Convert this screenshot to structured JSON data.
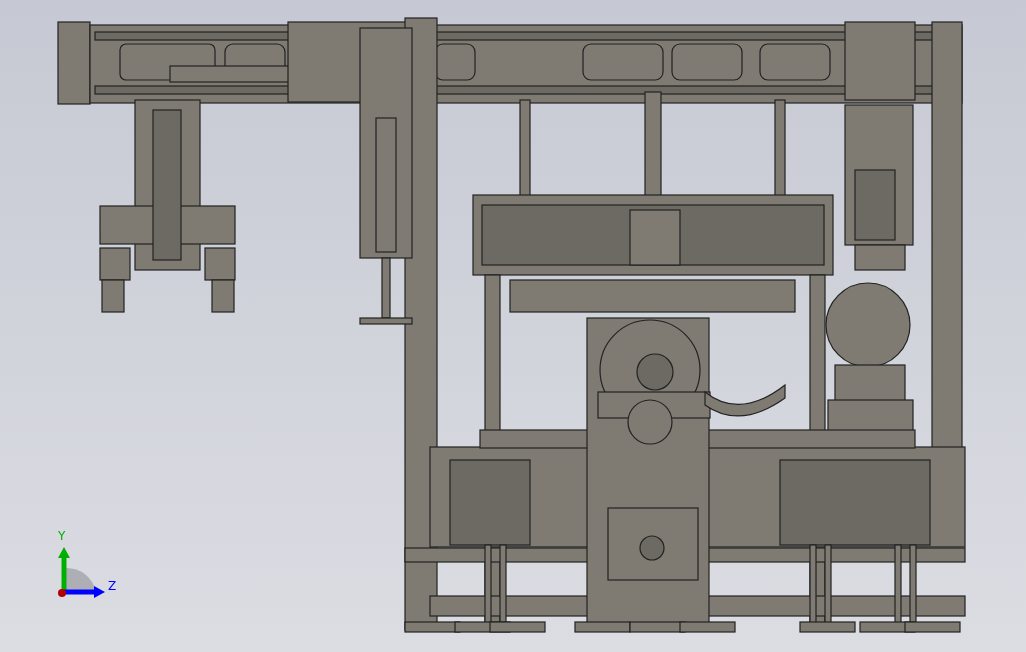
{
  "viewport": {
    "triad": {
      "axes": [
        {
          "label": "Y",
          "color": "#00b000"
        },
        {
          "label": "Z",
          "color": "#0000ff"
        }
      ]
    }
  }
}
